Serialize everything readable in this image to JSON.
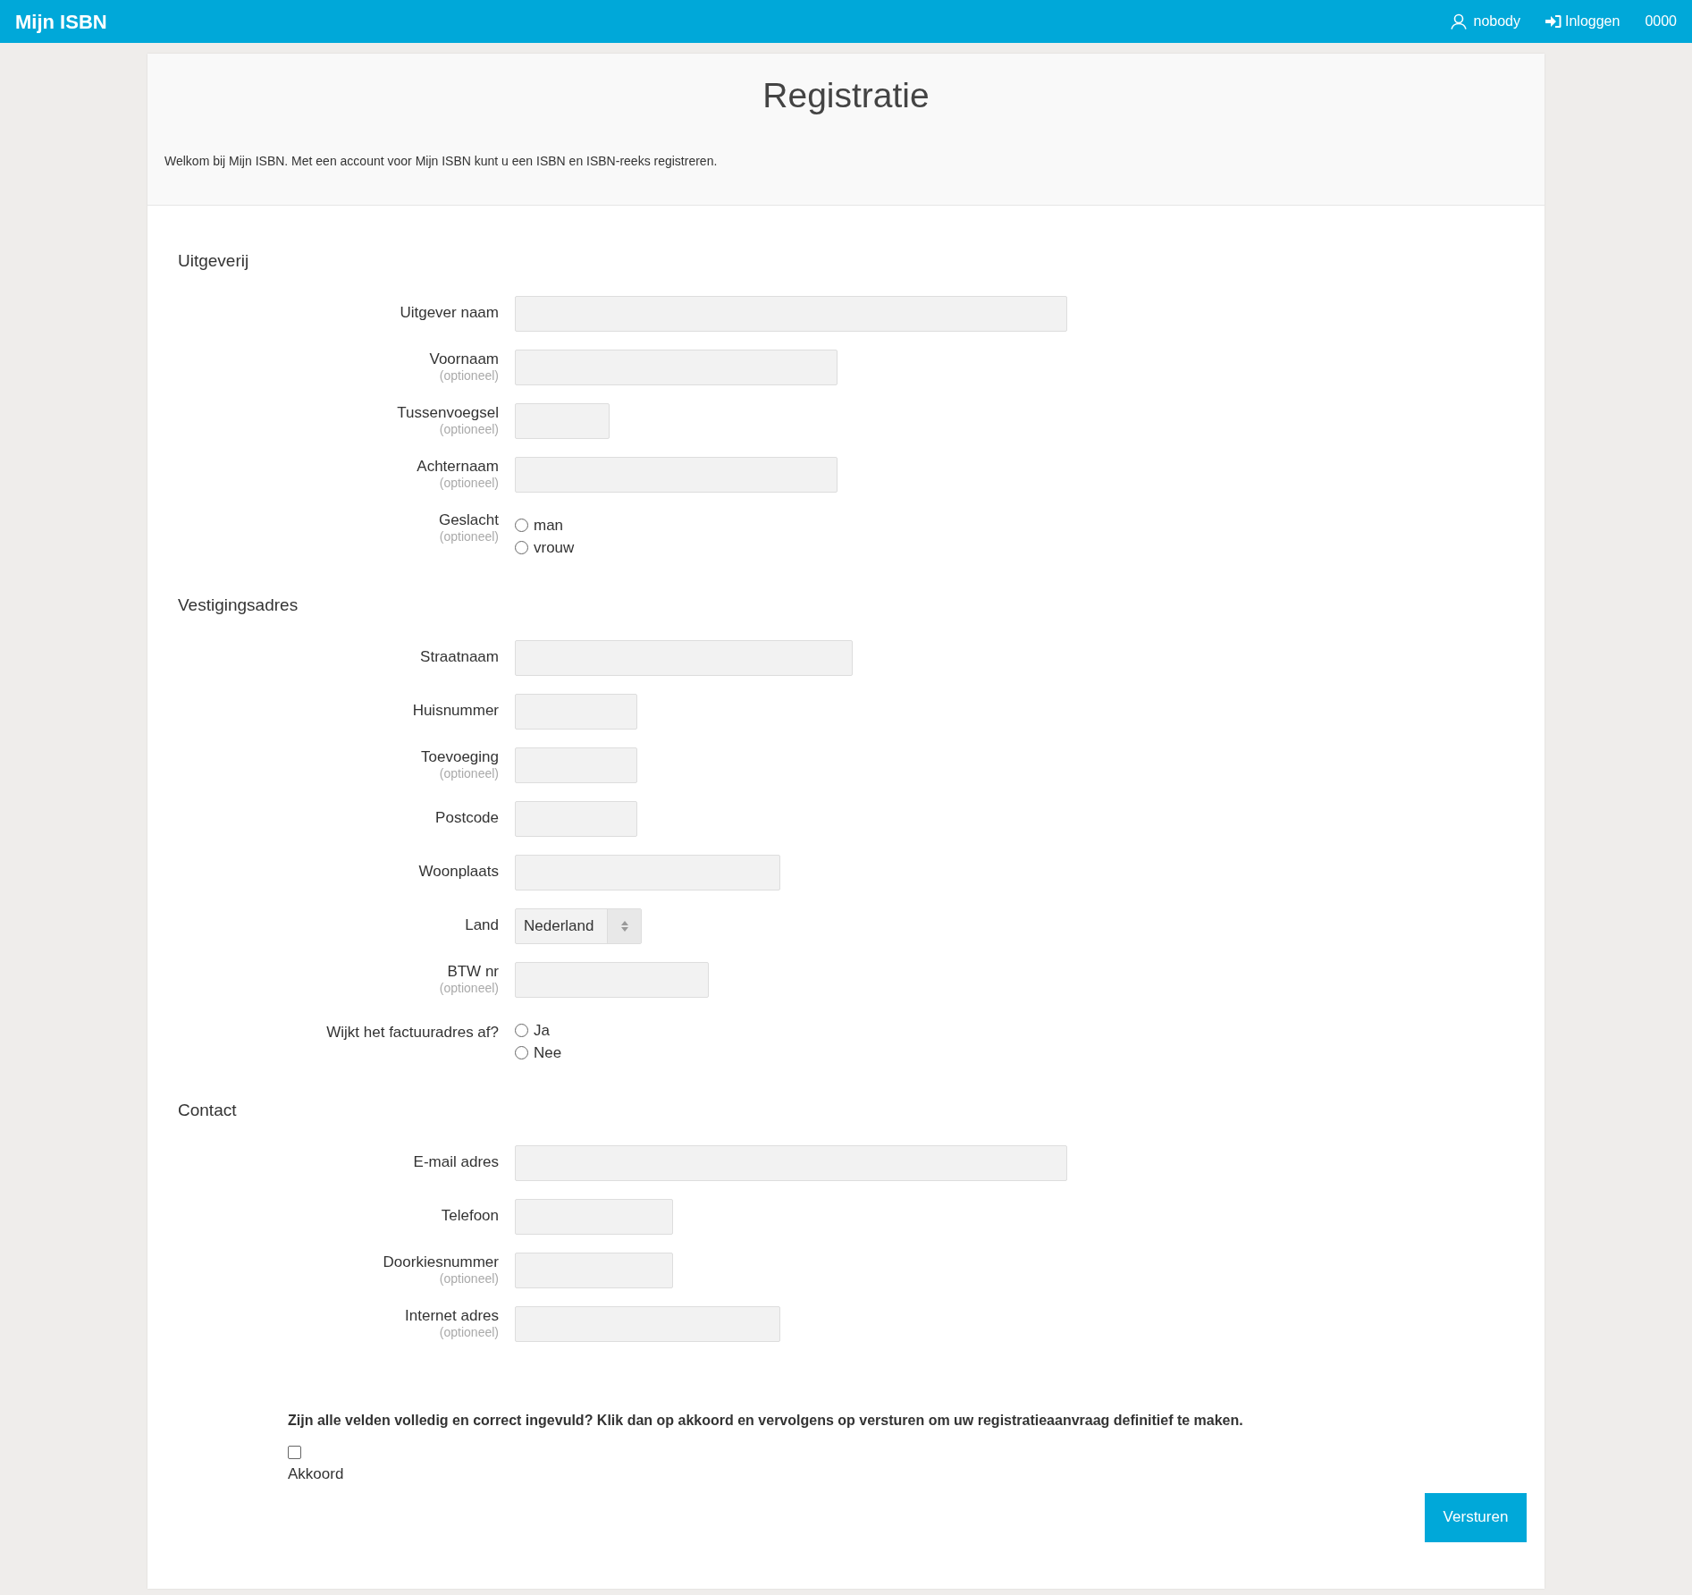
{
  "navbar": {
    "brand": "Mijn ISBN",
    "user": "nobody",
    "login": "Inloggen",
    "code": "0000"
  },
  "intro": {
    "title": "Registratie",
    "text": "Welkom bij Mijn ISBN. Met een account voor Mijn ISBN kunt u een ISBN en ISBN-reeks registreren."
  },
  "sections": [
    {
      "title": "Uitgeverij",
      "fields": [
        {
          "kind": "text",
          "label": "Uitgever naam"
        },
        {
          "kind": "text",
          "label": "Voornaam",
          "hint": "(optioneel)"
        },
        {
          "kind": "text",
          "label": "Tussenvoegsel",
          "hint": "(optioneel)"
        },
        {
          "kind": "text",
          "label": "Achternaam",
          "hint": "(optioneel)"
        },
        {
          "kind": "radio",
          "label": "Geslacht",
          "hint": "(optioneel)",
          "options": [
            {
              "label": "man",
              "selected": false
            },
            {
              "label": "vrouw",
              "selected": false
            }
          ]
        }
      ]
    },
    {
      "title": "Vestigingsadres",
      "fields": [
        {
          "kind": "text",
          "label": "Straatnaam"
        },
        {
          "kind": "text",
          "label": "Huisnummer"
        },
        {
          "kind": "text",
          "label": "Toevoeging",
          "hint": "(optioneel)"
        },
        {
          "kind": "text",
          "label": "Postcode"
        },
        {
          "kind": "text",
          "label": "Woonplaats"
        },
        {
          "kind": "select",
          "label": "Land",
          "value": "Nederland"
        },
        {
          "kind": "text",
          "label": "BTW nr",
          "hint": "(optioneel)"
        },
        {
          "kind": "radio",
          "label": "Wijkt het factuuradres af?",
          "options": [
            {
              "label": "Ja",
              "selected": false
            },
            {
              "label": "Nee",
              "selected": false
            }
          ]
        }
      ]
    },
    {
      "title": "Contact",
      "fields": [
        {
          "kind": "text",
          "label": "E-mail adres"
        },
        {
          "kind": "text",
          "label": "Telefoon"
        },
        {
          "kind": "text",
          "label": "Doorkiesnummer",
          "hint": "(optioneel)"
        },
        {
          "kind": "text",
          "label": "Internet adres",
          "hint": "(optioneel)"
        }
      ]
    }
  ],
  "confirm": {
    "question": "Zijn alle velden volledig en correct ingevuld? Klik dan op akkoord en vervolgens op versturen om uw registratieaanvraag definitief te maken.",
    "checkbox_label": "Akkoord",
    "checked": false
  },
  "submit": "Versturen"
}
